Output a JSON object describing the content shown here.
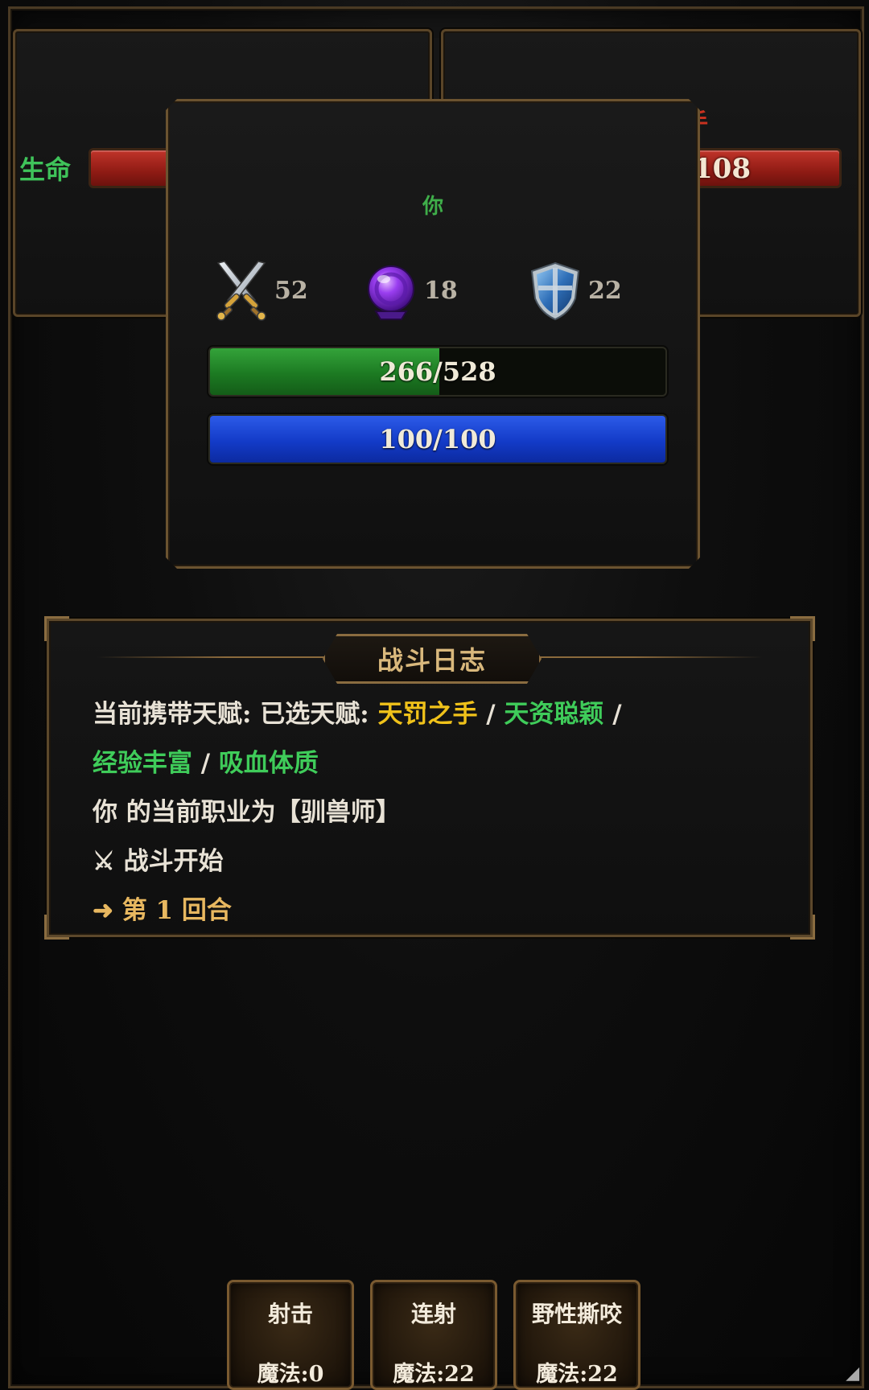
{
  "hp_label": "生命",
  "enemy": {
    "name_fragment": "手",
    "hp_text": "108"
  },
  "player": {
    "name": "你",
    "attack": "52",
    "magic": "18",
    "defense": "22",
    "hp": {
      "current": 266,
      "max": 528,
      "text": "266/528"
    },
    "mp": {
      "current": 100,
      "max": 100,
      "text": "100/100"
    }
  },
  "icons": {
    "attack": "crossed-swords-icon",
    "magic": "crystal-ball-icon",
    "defense": "shield-icon"
  },
  "colors": {
    "hp_fill": "#1c7a22",
    "mp_fill": "#133bc8",
    "talent_yellow": "#f0c21a",
    "talent_green": "#3fcc5a",
    "frame_gold": "#8a6c40"
  },
  "battle_log": {
    "title": "战斗日志",
    "line1": {
      "prefix": "当前携带天赋: 已选天赋: ",
      "talent1": "天罚之手",
      "sep1": " / ",
      "talent2": "天资聪颖",
      "sep2": " /"
    },
    "line2": {
      "talent3": "经验丰富",
      "sep3": " / ",
      "talent4": "吸血体质"
    },
    "line3": "你 的当前职业为【驯兽师】",
    "line4": "⚔ 战斗开始",
    "line5": "➜ 第 1 回合"
  },
  "skills": [
    {
      "name": "射击",
      "cost": "魔法:0"
    },
    {
      "name": "连射",
      "cost": "魔法:22"
    },
    {
      "name": "野性撕咬",
      "cost": "魔法:22"
    }
  ],
  "corner_glyph": "◢"
}
